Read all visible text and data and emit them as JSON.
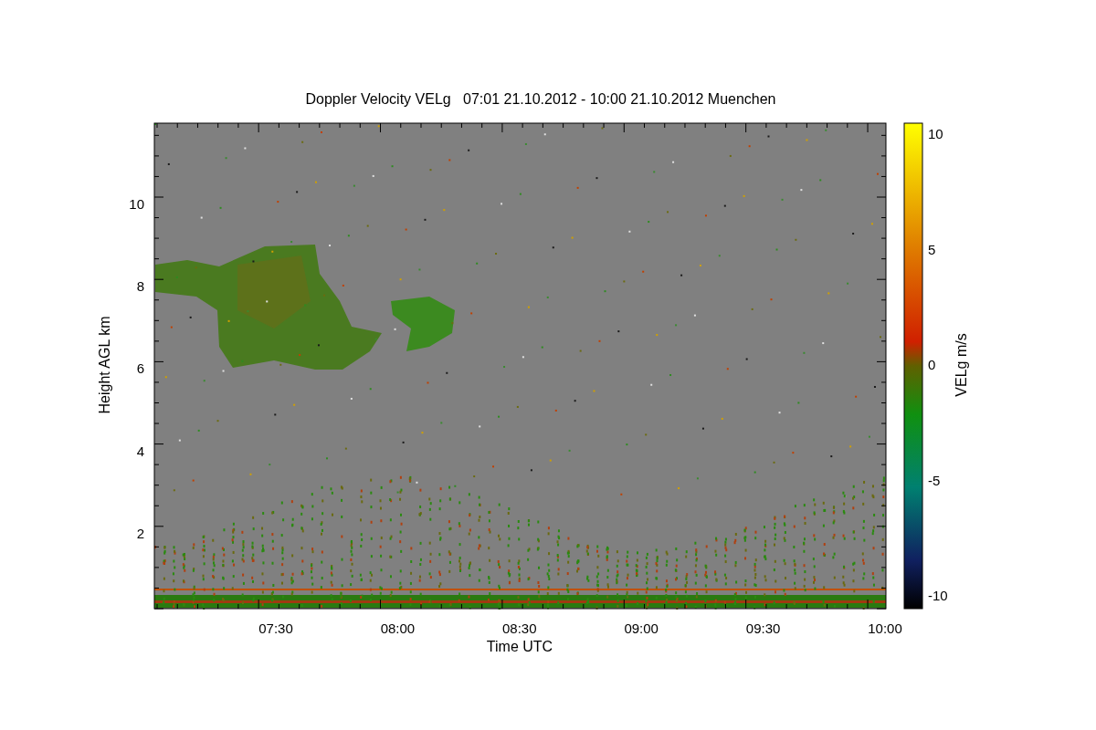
{
  "title": "Doppler Velocity VELg   07:01 21.10.2012 - 10:00 21.10.2012 Muenchen",
  "plot": {
    "xlabel": "Time UTC",
    "ylabel": "Height AGL km",
    "xticks": [
      "07:30",
      "08:00",
      "08:30",
      "09:00",
      "09:30",
      "10:00"
    ],
    "yticks": [
      "10",
      "8",
      "6",
      "4",
      "2"
    ]
  },
  "colorbar": {
    "label": "VELg m/s",
    "ticks": [
      "10",
      "5",
      "0",
      "-5",
      "-10"
    ]
  }
}
